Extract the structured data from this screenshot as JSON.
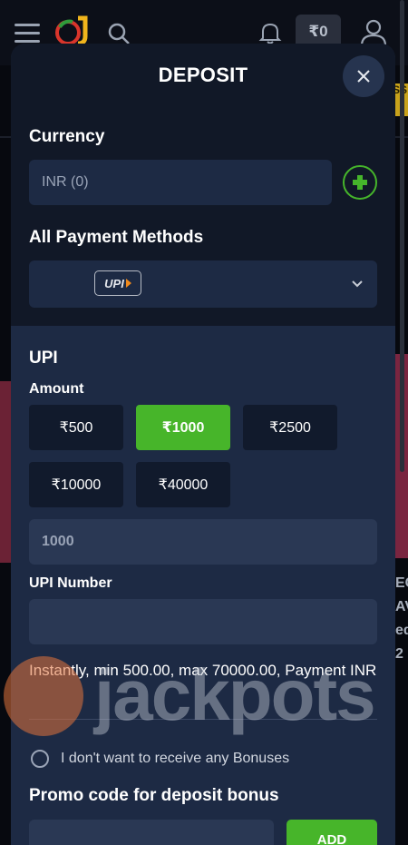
{
  "header": {
    "balance": "₹0"
  },
  "background": {
    "promo_badge": "SS",
    "side_text": [
      "EG",
      "AV",
      "ed",
      "2"
    ]
  },
  "modal": {
    "title": "DEPOSIT",
    "currency": {
      "label": "Currency",
      "value": "INR (0)"
    },
    "payment_methods": {
      "label": "All Payment Methods",
      "selected": "UPI"
    },
    "upi": {
      "title": "UPI",
      "amount_label": "Amount",
      "amounts": [
        "₹500",
        "₹1000",
        "₹2500",
        "₹10000",
        "₹40000"
      ],
      "selected_amount": "₹1000",
      "amount_value": "1000",
      "upi_number_label": "UPI Number",
      "upi_number_value": "",
      "info": "Instantly, min 500.00, max 70000.00, Payment INR",
      "no_bonus_label": "I don't want to receive any Bonuses",
      "promo_label": "Promo code for deposit bonus",
      "promo_value": "",
      "add_button": "ADD"
    }
  },
  "watermark": {
    "text": "jackpots"
  },
  "colors": {
    "accent_green": "#47b52a",
    "modal_bg": "#1d2a44",
    "modal_header_bg": "#111827"
  }
}
